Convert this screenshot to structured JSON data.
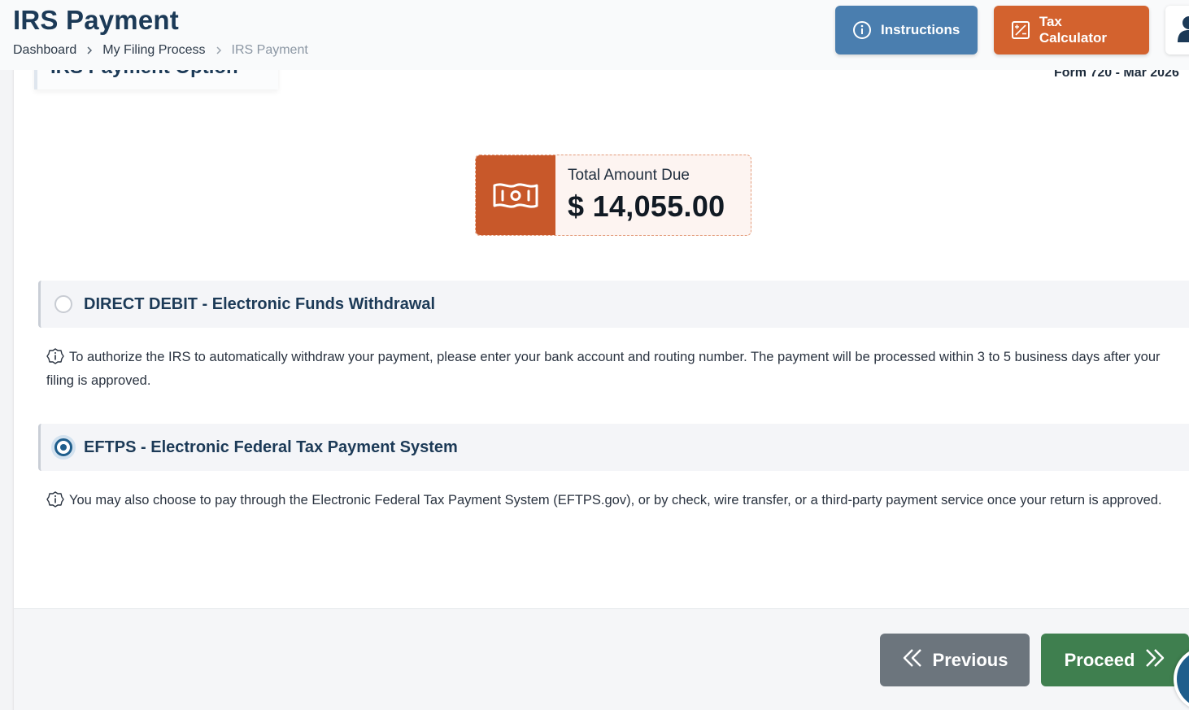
{
  "header": {
    "title": "IRS Payment",
    "breadcrumb": [
      "Dashboard",
      "My Filing Process",
      "IRS Payment"
    ],
    "instructions_label": "Instructions",
    "tax_calculator_label": "Tax Calculator"
  },
  "section": {
    "tab_title": "IRS Payment Option",
    "form_label": "Form 720 - Mar 2026"
  },
  "amount": {
    "label": "Total Amount Due",
    "value": "$ 14,055.00"
  },
  "options": [
    {
      "label": "DIRECT DEBIT - Electronic Funds Withdrawal",
      "selected": false,
      "info": "To authorize the IRS to automatically withdraw your payment, please enter your bank account and routing number. The payment will be processed within 3 to 5 business days after your filing is approved."
    },
    {
      "label": "EFTPS - Electronic Federal Tax Payment System",
      "selected": true,
      "info": "You may also choose to pay through the Electronic Federal Tax Payment System (EFTPS.gov), or by check, wire transfer, or a third-party payment service once your return is approved."
    }
  ],
  "footer": {
    "previous_label": "Previous",
    "proceed_label": "Proceed"
  },
  "icons": {
    "instructions": "info-circle-icon",
    "calculator": "calculator-icon",
    "user": "user-icon",
    "money": "money-bill-icon",
    "info": "info-badge-icon",
    "previous": "double-chevron-left-icon",
    "proceed": "double-chevron-right-icon"
  },
  "colors": {
    "primary": "#4a7eaf",
    "accent": "#d3622e",
    "success": "#3f7f4f",
    "secondary": "#6c757d",
    "title": "#1c3a57"
  }
}
